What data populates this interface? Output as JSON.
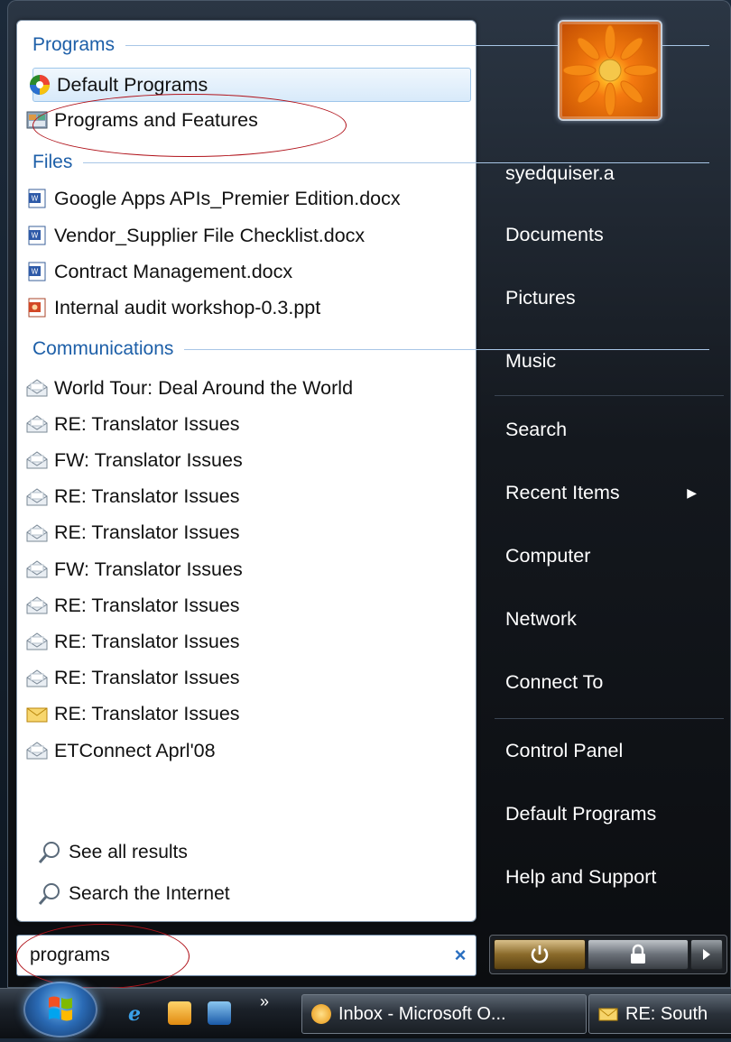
{
  "left": {
    "sections": {
      "programs": "Programs",
      "files": "Files",
      "communications": "Communications"
    },
    "programs": [
      {
        "label": "Default Programs",
        "icon": "default-programs-icon"
      },
      {
        "label": "Programs and Features",
        "icon": "programs-features-icon"
      }
    ],
    "files": [
      {
        "label": "Google Apps APIs_Premier Edition.docx",
        "icon": "word-doc-icon"
      },
      {
        "label": "Vendor_Supplier File Checklist.docx",
        "icon": "word-doc-icon"
      },
      {
        "label": "Contract Management.docx",
        "icon": "word-doc-icon"
      },
      {
        "label": "Internal audit workshop-0.3.ppt",
        "icon": "powerpoint-icon"
      }
    ],
    "communications": [
      {
        "label": "World Tour: Deal Around the World",
        "icon": "open-mail-icon"
      },
      {
        "label": "RE: Translator Issues",
        "icon": "open-mail-icon"
      },
      {
        "label": "FW: Translator Issues",
        "icon": "open-mail-icon"
      },
      {
        "label": "RE: Translator Issues",
        "icon": "open-mail-icon"
      },
      {
        "label": "RE: Translator Issues",
        "icon": "open-mail-icon"
      },
      {
        "label": "FW: Translator Issues",
        "icon": "open-mail-icon"
      },
      {
        "label": "RE: Translator Issues",
        "icon": "open-mail-icon"
      },
      {
        "label": "RE: Translator Issues",
        "icon": "open-mail-icon"
      },
      {
        "label": "RE: Translator Issues",
        "icon": "open-mail-icon"
      },
      {
        "label": "RE: Translator Issues",
        "icon": "closed-mail-icon"
      },
      {
        "label": "ETConnect Aprl'08",
        "icon": "open-mail-icon"
      }
    ],
    "see_all_results": "See all results",
    "search_internet": "Search the Internet"
  },
  "search": {
    "value": "programs",
    "clear": "×"
  },
  "right": {
    "items": [
      "syedquiser.a",
      "Documents",
      "Pictures",
      "Music",
      "Search",
      "Recent Items",
      "Computer",
      "Network",
      "Connect To",
      "Control Panel",
      "Default Programs",
      "Help and Support"
    ],
    "recent_arrow": "▶"
  },
  "taskbar": {
    "overflow": "»",
    "buttons": [
      {
        "label": "Inbox - Microsoft O...",
        "icon": "outlook-icon"
      },
      {
        "label": "RE: South",
        "icon": "mail-icon"
      }
    ]
  },
  "colors": {
    "section_text": "#1d5fa8",
    "annotation_ellipse": "#b0121a"
  }
}
